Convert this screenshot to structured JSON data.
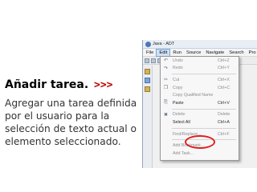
{
  "slide": {
    "title": "Añadir tarea.",
    "arrows": ">>>",
    "body": "Agregar una tarea definida por el usuario para la selección de texto actual o elemento seleccionado."
  },
  "app": {
    "window_title": "Java - ADT",
    "menubar": [
      "File",
      "Edit",
      "Run",
      "Source",
      "Navigate",
      "Search",
      "Pro"
    ],
    "active_menu": "Edit",
    "menu_items": [
      {
        "label": "Undo",
        "shortcut": "Ctrl+Z",
        "icon": "undo-icon",
        "disabled": true
      },
      {
        "label": "Redo",
        "shortcut": "Ctrl+Y",
        "icon": "redo-icon",
        "disabled": true
      },
      {
        "sep": true
      },
      {
        "label": "Cut",
        "shortcut": "Ctrl+X",
        "icon": "cut-icon",
        "disabled": true
      },
      {
        "label": "Copy",
        "shortcut": "Ctrl+C",
        "icon": "copy-icon",
        "disabled": true
      },
      {
        "label": "Copy Qualified Name",
        "shortcut": "",
        "icon": "",
        "disabled": true
      },
      {
        "label": "Paste",
        "shortcut": "Ctrl+V",
        "icon": "paste-icon",
        "disabled": false
      },
      {
        "sep": true
      },
      {
        "label": "Delete",
        "shortcut": "Delete",
        "icon": "delete-icon",
        "disabled": true
      },
      {
        "label": "Select All",
        "shortcut": "Ctrl+A",
        "icon": "",
        "disabled": false
      },
      {
        "sep": true
      },
      {
        "label": "Find/Replace...",
        "shortcut": "Ctrl+F",
        "icon": "",
        "disabled": true
      },
      {
        "sep": true
      },
      {
        "label": "Add Bookmark...",
        "shortcut": "",
        "icon": "",
        "disabled": true
      },
      {
        "label": "Add Task...",
        "shortcut": "",
        "icon": "",
        "disabled": true
      }
    ]
  },
  "colors": {
    "arrows": "#c00000",
    "highlight_ring": "#e02020"
  }
}
